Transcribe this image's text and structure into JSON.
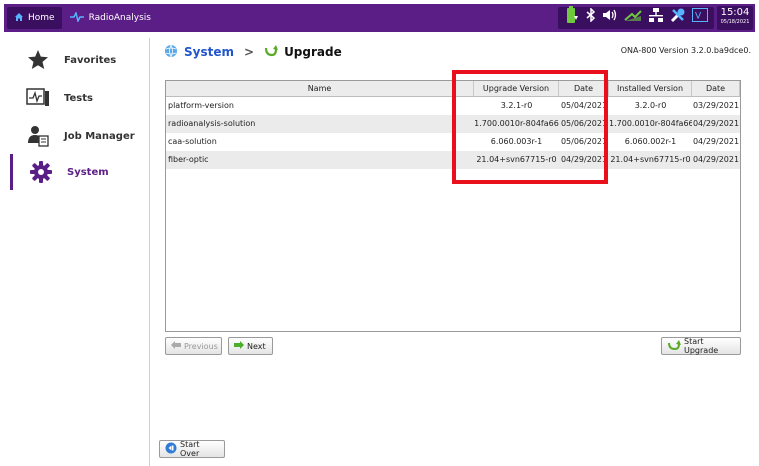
{
  "topbar": {
    "home_label": "Home",
    "app_label": "RadioAnalysis",
    "time": "15:04",
    "date": "05/18/2021",
    "status_icons": [
      "battery-charging-icon",
      "bluetooth-icon",
      "volume-icon",
      "signal-icon",
      "network-icon",
      "tools-icon",
      "vnc-icon"
    ]
  },
  "sidebar": {
    "items": [
      {
        "label": "Favorites",
        "icon": "star-icon"
      },
      {
        "label": "Tests",
        "icon": "tests-icon"
      },
      {
        "label": "Job Manager",
        "icon": "job-manager-icon"
      },
      {
        "label": "System",
        "icon": "gear-icon",
        "active": true
      }
    ]
  },
  "main": {
    "breadcrumb": {
      "system": "System",
      "separator": ">",
      "upgrade": "Upgrade"
    },
    "version": "ONA-800 Version 3.2.0.ba9dce0.",
    "table": {
      "headers": [
        "Name",
        "Upgrade Version",
        "Date",
        "Installed Version",
        "Date"
      ],
      "rows": [
        [
          "platform-version",
          "3.2.1-r0",
          "05/04/2021",
          "3.2.0-r0",
          "03/29/2021"
        ],
        [
          "radioanalysis-solution",
          "1.700.0010r-804fa66",
          "05/06/2021",
          "1.700.0010r-804fa66",
          "04/29/2021"
        ],
        [
          "caa-solution",
          "6.060.003r-1",
          "05/06/2021",
          "6.060.002r-1",
          "04/29/2021"
        ],
        [
          "fiber-optic",
          "21.04+svn67715-r0",
          "04/29/2021",
          "21.04+svn67715-r0",
          "04/29/2021"
        ]
      ]
    },
    "buttons": {
      "previous": "Previous",
      "next": "Next",
      "start_upgrade": "Start Upgrade",
      "start_over": "Start Over"
    }
  },
  "colors": {
    "accent": "#5b1e86",
    "highlight": "#e8101a",
    "link": "#2255cc"
  }
}
